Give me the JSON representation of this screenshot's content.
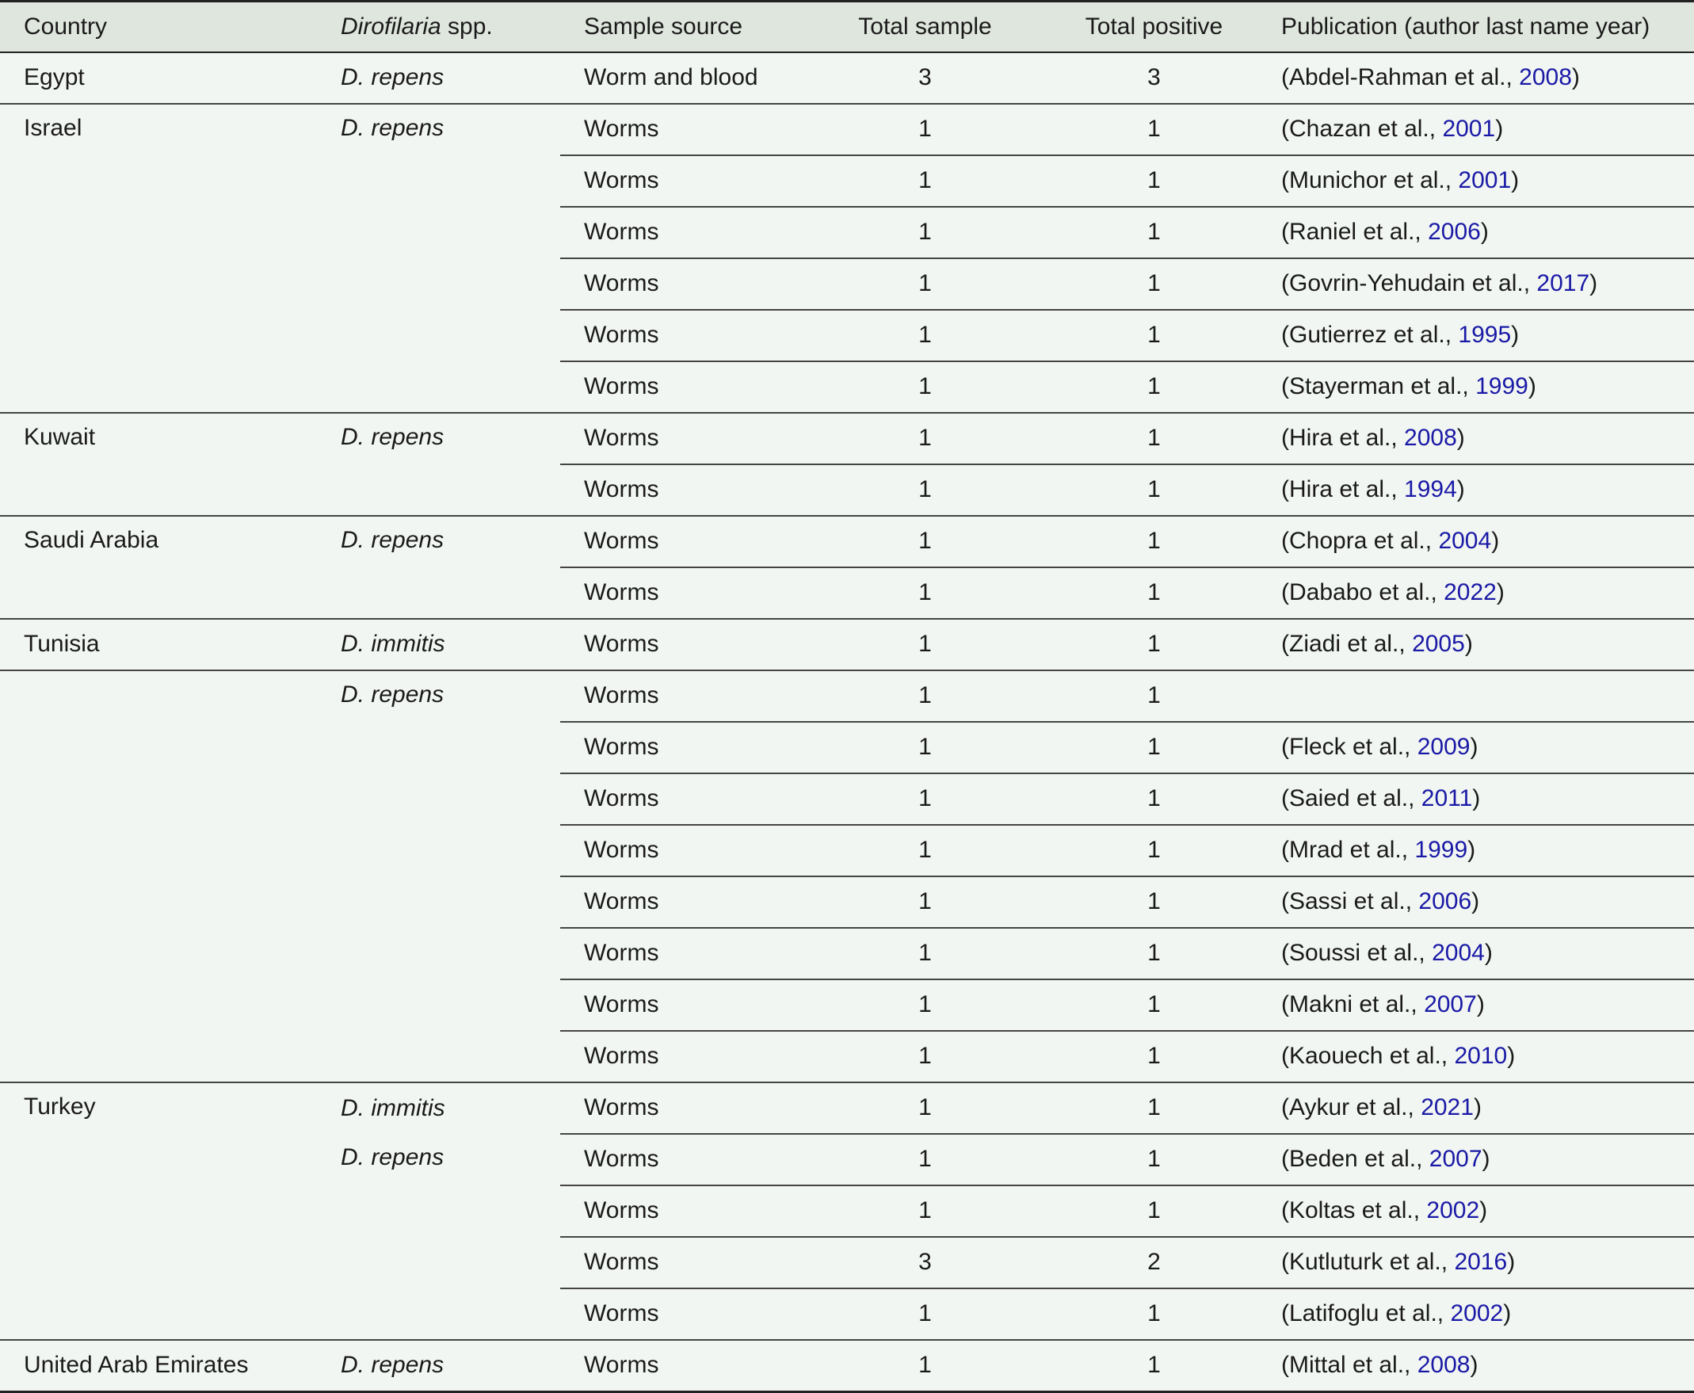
{
  "headers": {
    "country": "Country",
    "species_italic": "Dirofilaria",
    "species_rest": " spp.",
    "sample_source": "Sample source",
    "total_sample": "Total sample",
    "total_positive": "Total positive",
    "publication": "Publication (author last name year)"
  },
  "rows": [
    {
      "country": "Egypt",
      "species": "D. repens",
      "source": "Worm and blood",
      "total": "3",
      "positive": "3",
      "pub_author": "(Abdel-Rahman et al., ",
      "pub_year": "2008",
      "pub_close": ")"
    },
    {
      "country": "Israel",
      "species": "D. repens",
      "source": "Worms",
      "total": "1",
      "positive": "1",
      "pub_author": "(Chazan et al., ",
      "pub_year": "2001",
      "pub_close": ")"
    },
    {
      "source": "Worms",
      "total": "1",
      "positive": "1",
      "pub_author": "(Munichor et al., ",
      "pub_year": "2001",
      "pub_close": ")"
    },
    {
      "source": "Worms",
      "total": "1",
      "positive": "1",
      "pub_author": "(Raniel et al., ",
      "pub_year": "2006",
      "pub_close": ")"
    },
    {
      "source": "Worms",
      "total": "1",
      "positive": "1",
      "pub_author": "(Govrin-Yehudain et al., ",
      "pub_year": "2017",
      "pub_close": ")"
    },
    {
      "source": "Worms",
      "total": "1",
      "positive": "1",
      "pub_author": "(Gutierrez et al., ",
      "pub_year": "1995",
      "pub_close": ")"
    },
    {
      "source": "Worms",
      "total": "1",
      "positive": "1",
      "pub_author": "(Stayerman et al., ",
      "pub_year": "1999",
      "pub_close": ")"
    },
    {
      "country": "Kuwait",
      "species": "D. repens",
      "source": "Worms",
      "total": "1",
      "positive": "1",
      "pub_author": "(Hira et al., ",
      "pub_year": "2008",
      "pub_close": ")"
    },
    {
      "source": "Worms",
      "total": "1",
      "positive": "1",
      "pub_author": "(Hira et al., ",
      "pub_year": "1994",
      "pub_close": ")"
    },
    {
      "country": "Saudi Arabia",
      "species": "D. repens",
      "source": "Worms",
      "total": "1",
      "positive": "1",
      "pub_author": "(Chopra et al., ",
      "pub_year": "2004",
      "pub_close": ")"
    },
    {
      "source": "Worms",
      "total": "1",
      "positive": "1",
      "pub_author": "(Dababo et al., ",
      "pub_year": "2022",
      "pub_close": ")"
    },
    {
      "country": "Tunisia",
      "species": "D. immitis",
      "source": "Worms",
      "total": "1",
      "positive": "1",
      "pub_author": "(Ziadi et al., ",
      "pub_year": "2005",
      "pub_close": ")"
    },
    {
      "country": "",
      "species": "D. repens",
      "source": "Worms",
      "total": "1",
      "positive": "1",
      "pub_author": "",
      "pub_year": "",
      "pub_close": ""
    },
    {
      "source": "Worms",
      "total": "1",
      "positive": "1",
      "pub_author": "(Fleck et al., ",
      "pub_year": "2009",
      "pub_close": ")"
    },
    {
      "source": "Worms",
      "total": "1",
      "positive": "1",
      "pub_author": "(Saied et al., ",
      "pub_year": "2011",
      "pub_close": ")"
    },
    {
      "source": "Worms",
      "total": "1",
      "positive": "1",
      "pub_author": "(Mrad et al., ",
      "pub_year": "1999",
      "pub_close": ")"
    },
    {
      "source": "Worms",
      "total": "1",
      "positive": "1",
      "pub_author": "(Sassi et al., ",
      "pub_year": "2006",
      "pub_close": ")"
    },
    {
      "source": "Worms",
      "total": "1",
      "positive": "1",
      "pub_author": "(Soussi et al., ",
      "pub_year": "2004",
      "pub_close": ")"
    },
    {
      "source": "Worms",
      "total": "1",
      "positive": "1",
      "pub_author": "(Makni et al., ",
      "pub_year": "2007",
      "pub_close": ")"
    },
    {
      "source": "Worms",
      "total": "1",
      "positive": "1",
      "pub_author": "(Kaouech et al., ",
      "pub_year": "2010",
      "pub_close": ")"
    },
    {
      "country": "Turkey",
      "species": "D. immitis",
      "source": "Worms",
      "total": "1",
      "positive": "1",
      "pub_author": "(Aykur et al., ",
      "pub_year": "2021",
      "pub_close": ")"
    },
    {
      "species": "D. repens",
      "source": "Worms",
      "total": "1",
      "positive": "1",
      "pub_author": "(Beden et al., ",
      "pub_year": "2007",
      "pub_close": ")"
    },
    {
      "source": "Worms",
      "total": "1",
      "positive": "1",
      "pub_author": "(Koltas et al., ",
      "pub_year": "2002",
      "pub_close": ")"
    },
    {
      "source": "Worms",
      "total": "3",
      "positive": "2",
      "pub_author": "(Kutluturk et al., ",
      "pub_year": "2016",
      "pub_close": ")"
    },
    {
      "source": "Worms",
      "total": "1",
      "positive": "1",
      "pub_author": "(Latifoglu et al., ",
      "pub_year": "2002",
      "pub_close": ")"
    },
    {
      "country": "United Arab Emirates",
      "species": "D. repens",
      "source": "Worms",
      "total": "1",
      "positive": "1",
      "pub_author": "(Mittal et al., ",
      "pub_year": "2008",
      "pub_close": ")"
    }
  ]
}
